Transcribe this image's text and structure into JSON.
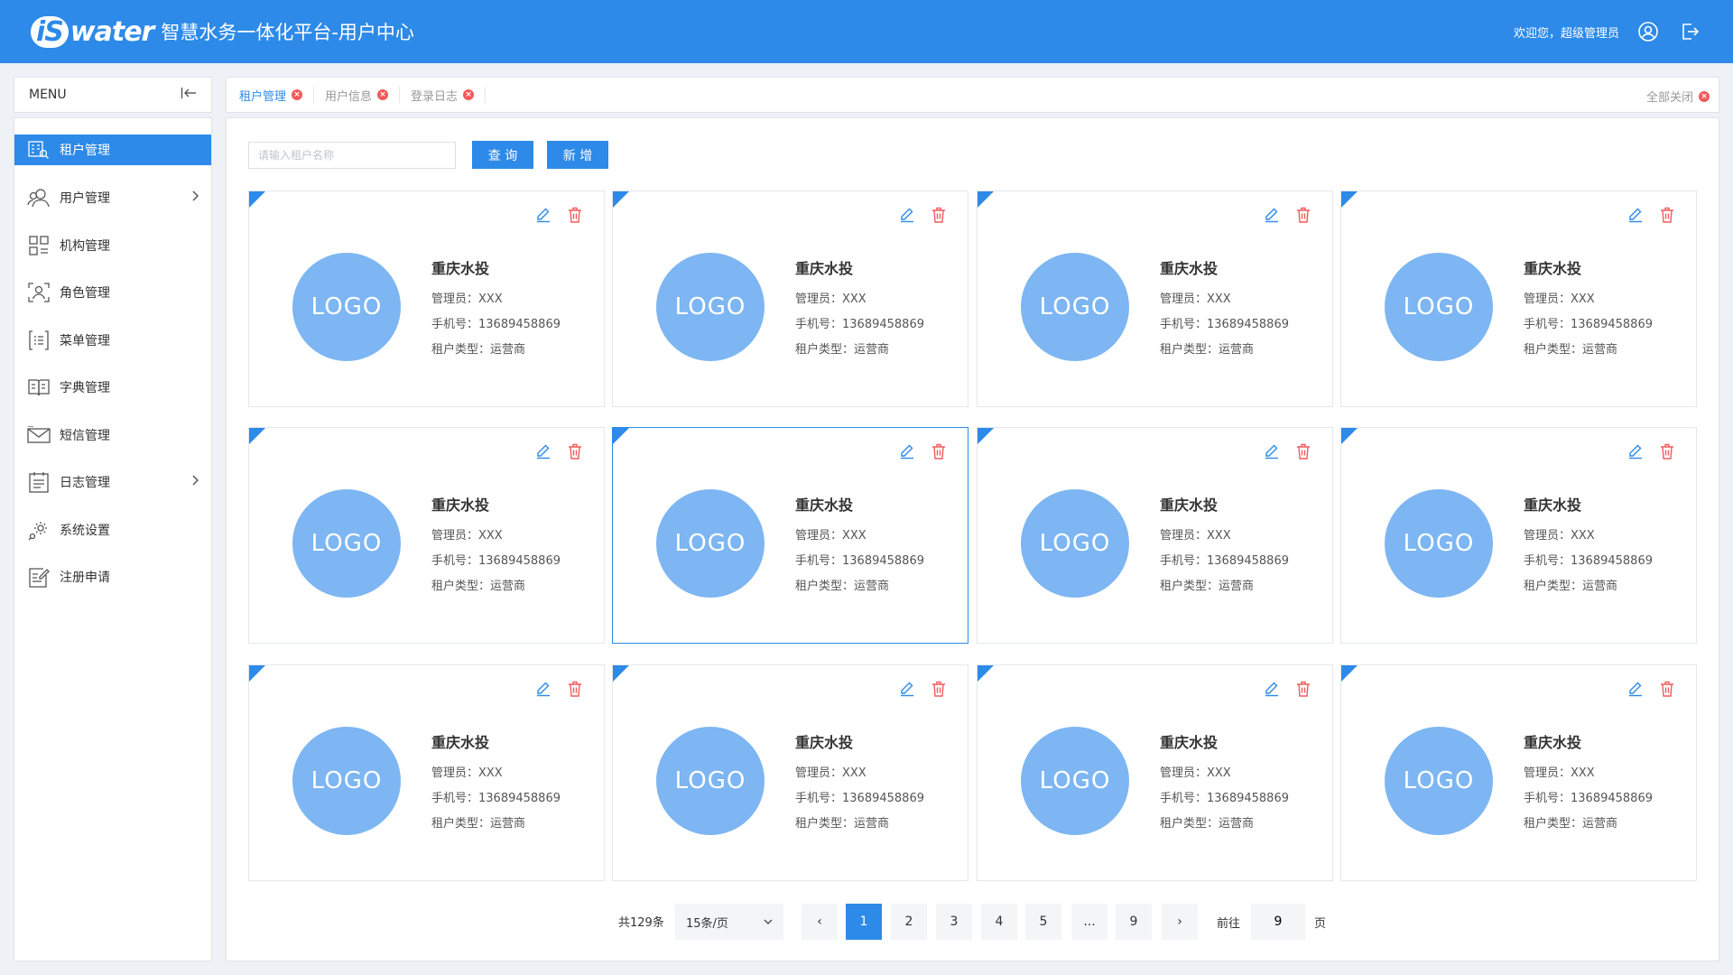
{
  "header": {
    "logo_text": "water",
    "logo_prefix": "iS",
    "title": "智慧水务一体化平台-用户中心",
    "welcome": "欢迎您，超级管理员"
  },
  "menu": {
    "title": "MENU",
    "items": [
      {
        "label": "租户管理",
        "icon": "tenant-icon",
        "active": true
      },
      {
        "label": "用户管理",
        "icon": "users-icon",
        "has_children": true
      },
      {
        "label": "机构管理",
        "icon": "org-icon"
      },
      {
        "label": "角色管理",
        "icon": "role-icon"
      },
      {
        "label": "菜单管理",
        "icon": "menu-list-icon"
      },
      {
        "label": "字典管理",
        "icon": "dictionary-icon"
      },
      {
        "label": "短信管理",
        "icon": "sms-icon"
      },
      {
        "label": "日志管理",
        "icon": "log-icon",
        "has_children": true
      },
      {
        "label": "系统设置",
        "icon": "settings-icon"
      },
      {
        "label": "注册申请",
        "icon": "register-icon"
      }
    ]
  },
  "tabs": {
    "items": [
      {
        "label": "租户管理",
        "active": true
      },
      {
        "label": "用户信息"
      },
      {
        "label": "登录日志"
      }
    ],
    "close_all": "全部关闭"
  },
  "search": {
    "placeholder": "请输入租户名称",
    "query_label": "查 询",
    "add_label": "新 增"
  },
  "cards": [
    {
      "logo": "LOGO",
      "name": "重庆水投",
      "admin": "管理员：XXX",
      "phone": "手机号：13689458869",
      "type": "租户类型：运营商"
    },
    {
      "logo": "LOGO",
      "name": "重庆水投",
      "admin": "管理员：XXX",
      "phone": "手机号：13689458869",
      "type": "租户类型：运营商"
    },
    {
      "logo": "LOGO",
      "name": "重庆水投",
      "admin": "管理员：XXX",
      "phone": "手机号：13689458869",
      "type": "租户类型：运营商"
    },
    {
      "logo": "LOGO",
      "name": "重庆水投",
      "admin": "管理员：XXX",
      "phone": "手机号：13689458869",
      "type": "租户类型：运营商"
    },
    {
      "logo": "LOGO",
      "name": "重庆水投",
      "admin": "管理员：XXX",
      "phone": "手机号：13689458869",
      "type": "租户类型：运营商"
    },
    {
      "logo": "LOGO",
      "name": "重庆水投",
      "admin": "管理员：XXX",
      "phone": "手机号：13689458869",
      "type": "租户类型：运营商",
      "selected": true
    },
    {
      "logo": "LOGO",
      "name": "重庆水投",
      "admin": "管理员：XXX",
      "phone": "手机号：13689458869",
      "type": "租户类型：运营商"
    },
    {
      "logo": "LOGO",
      "name": "重庆水投",
      "admin": "管理员：XXX",
      "phone": "手机号：13689458869",
      "type": "租户类型：运营商"
    },
    {
      "logo": "LOGO",
      "name": "重庆水投",
      "admin": "管理员：XXX",
      "phone": "手机号：13689458869",
      "type": "租户类型：运营商"
    },
    {
      "logo": "LOGO",
      "name": "重庆水投",
      "admin": "管理员：XXX",
      "phone": "手机号：13689458869",
      "type": "租户类型：运营商"
    },
    {
      "logo": "LOGO",
      "name": "重庆水投",
      "admin": "管理员：XXX",
      "phone": "手机号：13689458869",
      "type": "租户类型：运营商"
    },
    {
      "logo": "LOGO",
      "name": "重庆水投",
      "admin": "管理员：XXX",
      "phone": "手机号：13689458869",
      "type": "租户类型：运营商"
    }
  ],
  "pagination": {
    "total": "共129条",
    "page_size": "15条/页",
    "pages": [
      "1",
      "2",
      "3",
      "4",
      "5",
      "...",
      "9"
    ],
    "current": "1",
    "prev": "‹",
    "next": "›",
    "goto_label": "前往",
    "goto_value": "9",
    "page_suffix": "页"
  },
  "colors": {
    "primary": "#2d8ae8",
    "logo_circle": "#7db6f2",
    "delete": "#f25a5a"
  }
}
